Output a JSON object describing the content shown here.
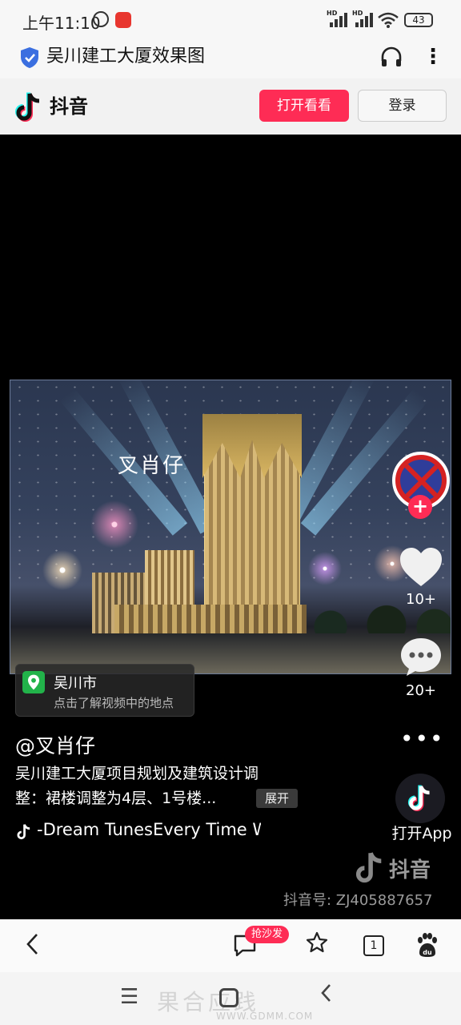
{
  "status_bar": {
    "time": "上午11:10",
    "battery": "43",
    "network_labels": [
      "HD",
      "HD"
    ]
  },
  "browser": {
    "page_title": "吴川建工大厦效果图"
  },
  "douyin_header": {
    "brand": "抖音",
    "open_button": "打开看看",
    "login_button": "登录",
    "accent_color": "#fe2c55"
  },
  "video": {
    "overlay_text": "叉肖仔"
  },
  "side_actions": {
    "follow_plus": "+",
    "likes": "10+",
    "comments": "20+",
    "more": "•••",
    "open_app": "打开App"
  },
  "location": {
    "city": "吴川市",
    "hint": "点击了解视频中的地点"
  },
  "post": {
    "author": "@叉肖仔",
    "desc_line1": "吴川建工大厦项目规划及建筑设计调",
    "desc_line2": "整：裙楼调整为4层、1号楼...",
    "expand": "展开",
    "music": "-Dream TunesEvery Time W"
  },
  "watermark": {
    "brand": "抖音",
    "douyin_id": "抖音号: ZJ405887657"
  },
  "toolbar": {
    "back_icon": "chevron-left-icon",
    "comment_badge": "抢沙发",
    "tab_count": "1"
  },
  "system_nav": {
    "site_watermark": "果合应践",
    "site_url": "WWW.GDMM.COM"
  }
}
